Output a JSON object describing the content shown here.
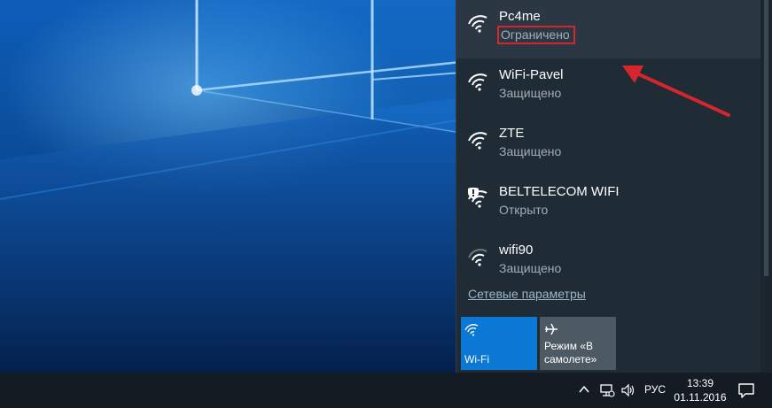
{
  "networks": [
    {
      "name": "Pc4me",
      "status": "Ограничено",
      "icon": "wifi-icon"
    },
    {
      "name": "WiFi-Pavel",
      "status": "Защищено",
      "icon": "wifi-icon"
    },
    {
      "name": "ZTE",
      "status": "Защищено",
      "icon": "wifi-icon"
    },
    {
      "name": "BELTELECOM WIFI",
      "status": "Открыто",
      "icon": "wifi-open-shield-icon"
    },
    {
      "name": "wifi90",
      "status": "Защищено",
      "icon": "wifi-weak-icon"
    }
  ],
  "network_settings_label": "Сетевые параметры",
  "quick_actions": {
    "wifi_label": "Wi-Fi",
    "airplane_label_line1": "Режим «В",
    "airplane_label_line2": "самолете»"
  },
  "taskbar": {
    "language": "РУС",
    "time": "13:39",
    "date": "01.11.2016"
  },
  "colors": {
    "flyout_bg": "#1f2b35",
    "accent": "#0a78d4",
    "highlight_box": "#d6252c",
    "arrow": "#d6252c"
  }
}
